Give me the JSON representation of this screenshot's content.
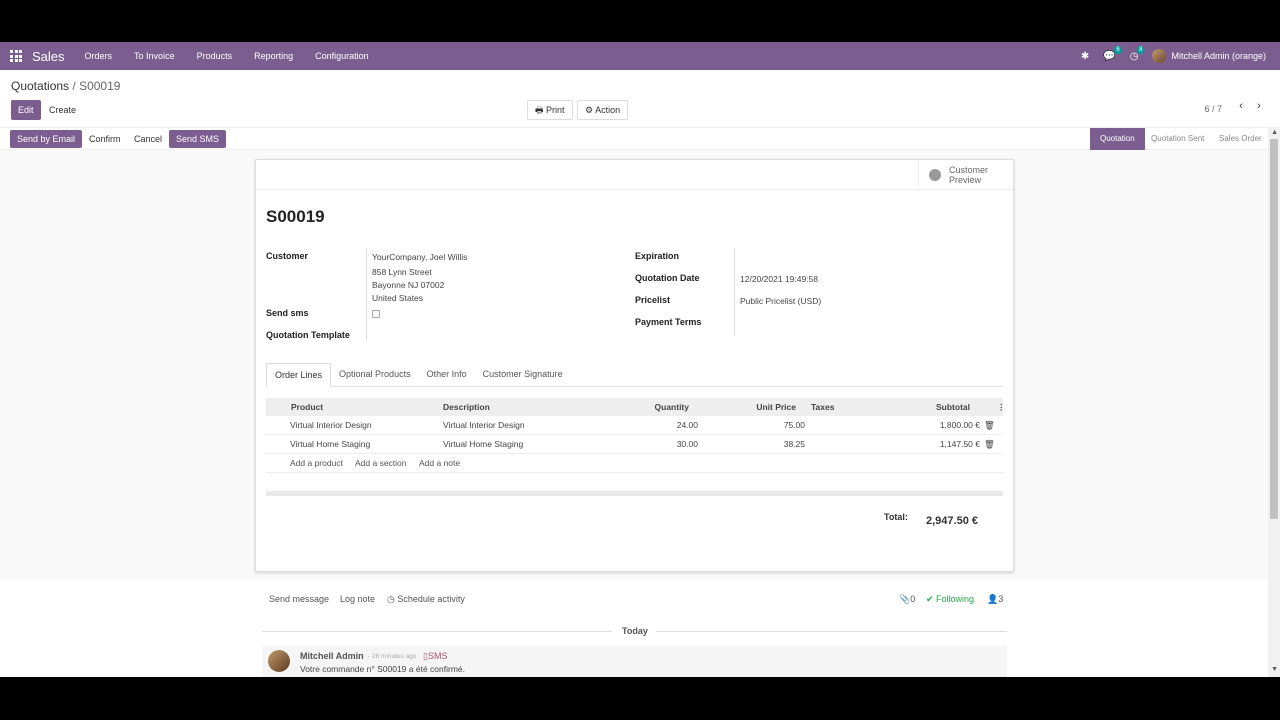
{
  "navbar": {
    "brand": "Sales",
    "menu": [
      "Orders",
      "To Invoice",
      "Products",
      "Reporting",
      "Configuration"
    ],
    "chat_badge": "6",
    "activity_badge": "8",
    "user": "Mitchell Admin (orange)"
  },
  "breadcrumb": {
    "parent": "Quotations",
    "separator": "/",
    "current": "S00019"
  },
  "actions": {
    "edit": "Edit",
    "create": "Create",
    "print": "Print",
    "action": "Action"
  },
  "pager": {
    "text": "6 / 7"
  },
  "buttons": {
    "send_email": "Send by Email",
    "confirm": "Confirm",
    "cancel": "Cancel",
    "send_sms": "Send SMS"
  },
  "stages": [
    "Quotation",
    "Quotation Sent",
    "Sales Order"
  ],
  "sheet": {
    "preview_line1": "Customer",
    "preview_line2": "Preview",
    "name": "S00019",
    "customer_label": "Customer",
    "customer_name": "YourCompany, Joel Willis",
    "address_street": "858 Lynn Street",
    "address_city": "Bayonne NJ 07002",
    "address_country": "United States",
    "send_sms_label": "Send sms",
    "quotation_template_label": "Quotation Template",
    "expiration_label": "Expiration",
    "quotation_date_label": "Quotation Date",
    "quotation_date": "12/20/2021 19:49:58",
    "pricelist_label": "Pricelist",
    "pricelist": "Public Pricelist (USD)",
    "payment_terms_label": "Payment Terms"
  },
  "tabs": [
    "Order Lines",
    "Optional Products",
    "Other Info",
    "Customer Signature"
  ],
  "table": {
    "headers": {
      "product": "Product",
      "description": "Description",
      "quantity": "Quantity",
      "unit_price": "Unit Price",
      "taxes": "Taxes",
      "subtotal": "Subtotal"
    },
    "rows": [
      {
        "product": "Virtual Interior Design",
        "description": "Virtual Interior Design",
        "quantity": "24.00",
        "unit_price": "75.00",
        "subtotal": "1,800.00 €"
      },
      {
        "product": "Virtual Home Staging",
        "description": "Virtual Home Staging",
        "quantity": "30.00",
        "unit_price": "38.25",
        "subtotal": "1,147.50 €"
      }
    ],
    "add_product": "Add a product",
    "add_section": "Add a section",
    "add_note": "Add a note"
  },
  "totals": {
    "label": "Total:",
    "value": "2,947.50 €"
  },
  "chatter": {
    "send_message": "Send message",
    "log_note": "Log note",
    "schedule_activity": "Schedule activity",
    "attachments": "0",
    "following": "Following",
    "followers": "3",
    "today": "Today",
    "message": {
      "author": "Mitchell Admin",
      "ago": "- 28 minutes ago",
      "type": "SMS",
      "text": "Votre commande n° S00019 a été confirmé."
    }
  }
}
